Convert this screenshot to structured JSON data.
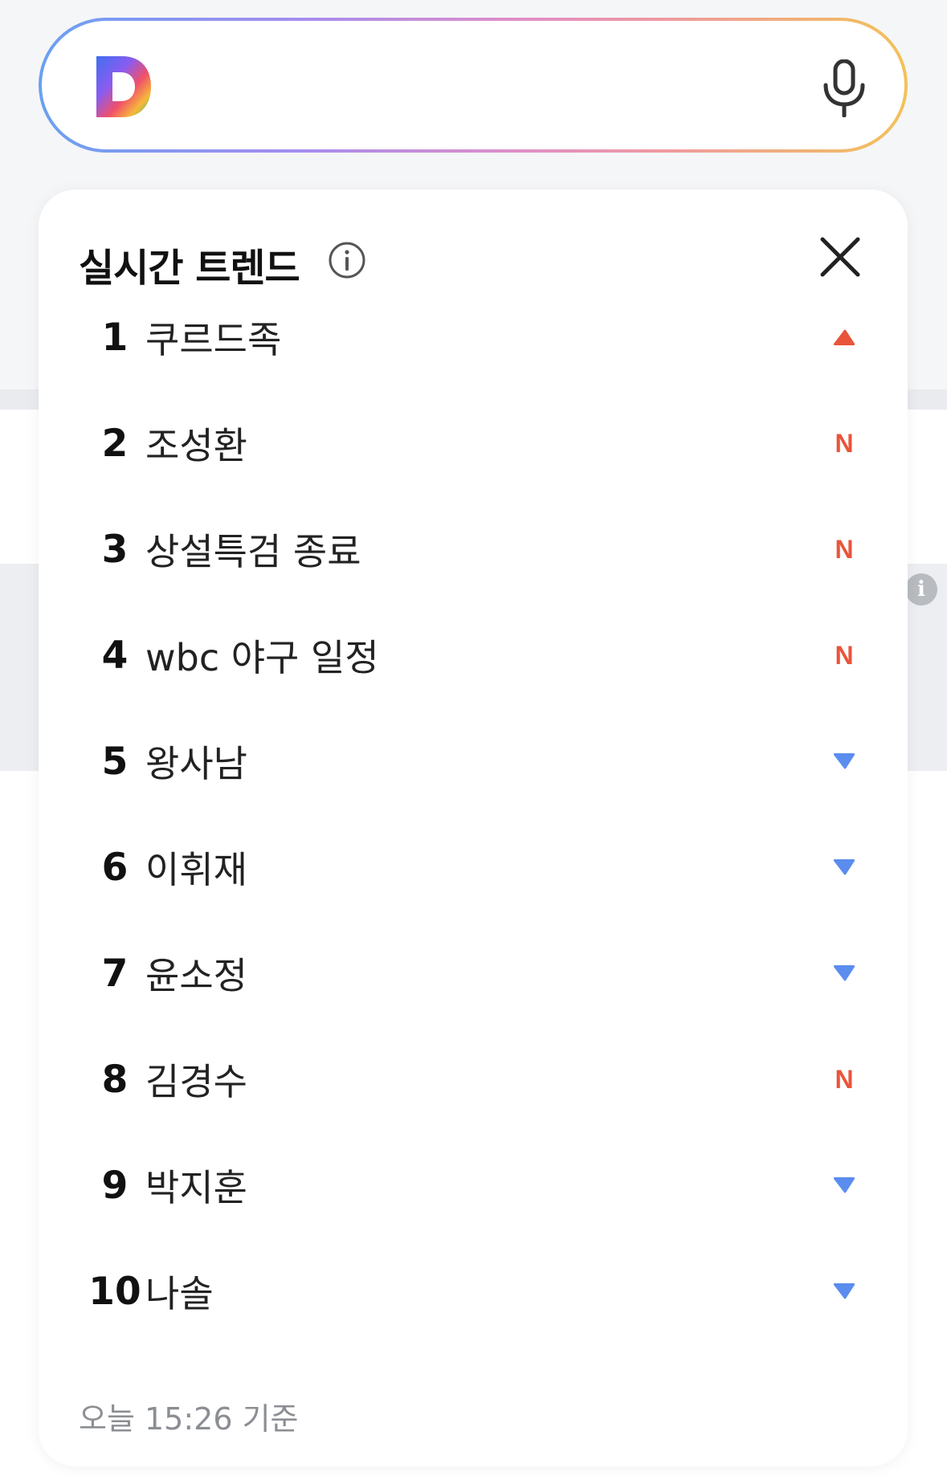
{
  "search": {
    "logo_letter": "D",
    "placeholder": "",
    "mic_icon": "microphone-icon"
  },
  "trends": {
    "title": "실시간 트렌드",
    "info_icon": "info-icon",
    "close_icon": "close-icon",
    "items": [
      {
        "rank": "1",
        "term": "쿠르드족",
        "status": "up"
      },
      {
        "rank": "2",
        "term": "조성환",
        "status": "new",
        "new_label": "N"
      },
      {
        "rank": "3",
        "term": "상설특검 종료",
        "status": "new",
        "new_label": "N"
      },
      {
        "rank": "4",
        "term": "wbc 야구 일정",
        "status": "new",
        "new_label": "N"
      },
      {
        "rank": "5",
        "term": "왕사남",
        "status": "down"
      },
      {
        "rank": "6",
        "term": "이휘재",
        "status": "down"
      },
      {
        "rank": "7",
        "term": "윤소정",
        "status": "down"
      },
      {
        "rank": "8",
        "term": "김경수",
        "status": "new",
        "new_label": "N"
      },
      {
        "rank": "9",
        "term": "박지훈",
        "status": "down"
      },
      {
        "rank": "10",
        "term": "나솔",
        "status": "down"
      }
    ],
    "updated": "오늘 15:26 기준"
  },
  "colors": {
    "up": "#e8553a",
    "new": "#e8553a",
    "down": "#5b8def",
    "gradient": [
      "#6aa0f0",
      "#a58df0",
      "#e08ec8",
      "#ef9aa0",
      "#f2c25a"
    ]
  }
}
